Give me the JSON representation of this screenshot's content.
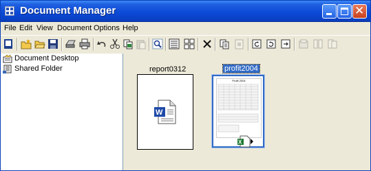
{
  "window": {
    "title": "Document Manager"
  },
  "menu": [
    "File",
    "Edit",
    "View",
    "Document",
    "Options",
    "Help"
  ],
  "toolbar": {
    "icons": [
      "new-doc-icon",
      "new-folder-icon",
      "open-folder-icon",
      "save-icon",
      "scan-icon",
      "print-icon",
      "undo-icon",
      "cut-icon",
      "copy-icon",
      "paste-icon",
      "search-icon",
      "details-view-icon",
      "thumbnails-view-icon",
      "delete-icon",
      "page-copy-icon",
      "page-paste-icon",
      "rotate-left-icon",
      "rotate-right-icon",
      "page-insert-icon",
      "stack-icon",
      "split-icon",
      "merge-icon"
    ]
  },
  "tree": [
    {
      "label": "Document Desktop",
      "icon": "desktop-icon"
    },
    {
      "label": "Shared Folder",
      "icon": "shared-folder-icon"
    }
  ],
  "documents": [
    {
      "name": "report0312",
      "type": "word",
      "selected": false
    },
    {
      "name": "profit2004",
      "type": "excel",
      "selected": true,
      "preview_title": "Profit 2004"
    }
  ],
  "colors": {
    "title_bar": "#0b49d6",
    "selection": "#316ac5",
    "window_bg": "#ece9d8"
  }
}
